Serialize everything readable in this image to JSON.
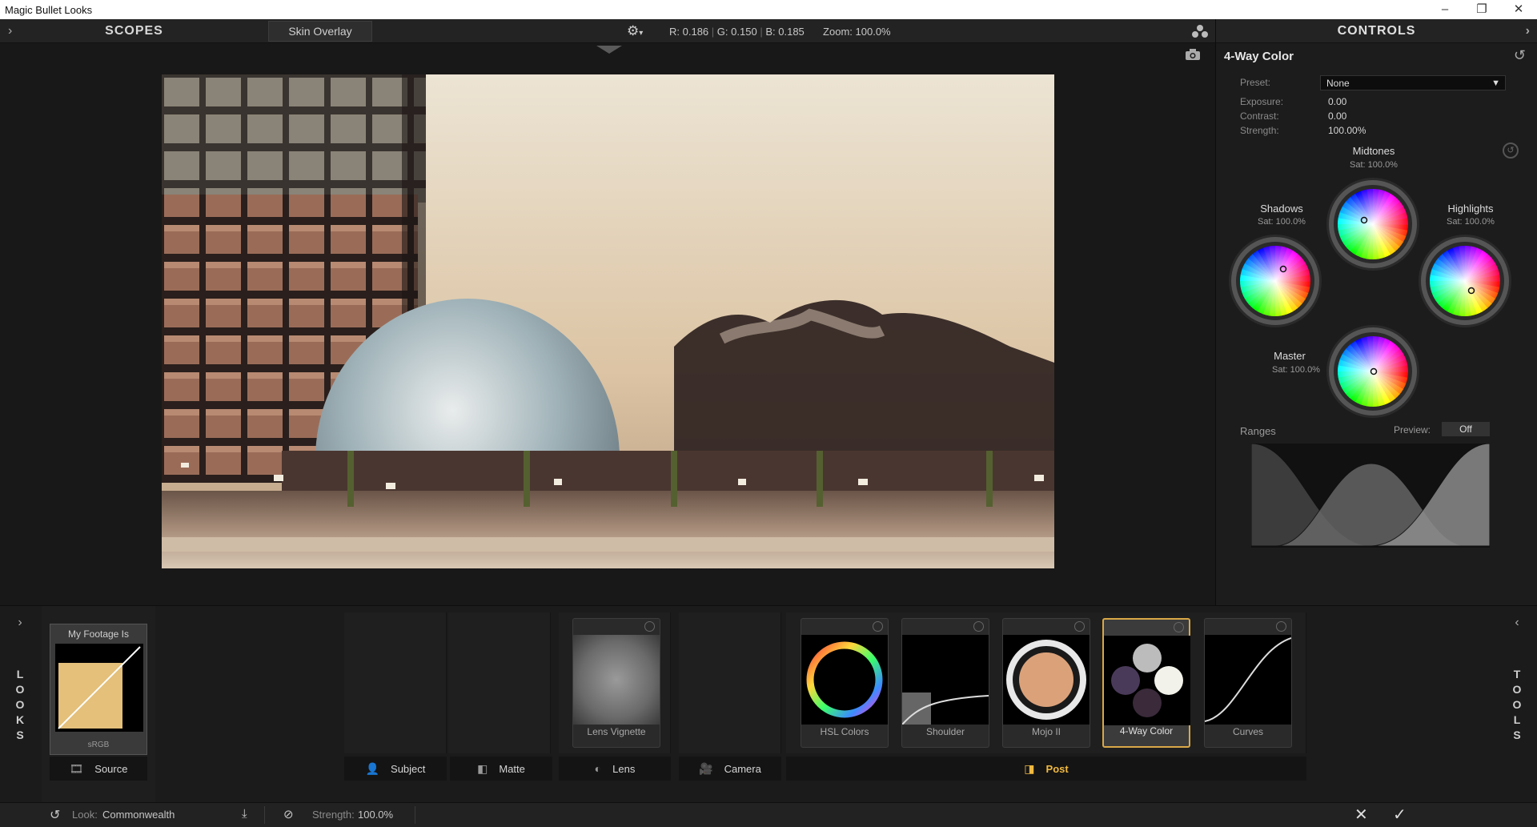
{
  "window": {
    "title": "Magic Bullet Looks",
    "minimize": "–",
    "maximize": "❐",
    "close": "✕"
  },
  "toolbar": {
    "scopes": "SCOPES",
    "skin_overlay": "Skin Overlay",
    "r_label": "R:",
    "r_value": "0.186",
    "g_label": "G:",
    "g_value": "0.150",
    "b_label": "B:",
    "b_value": "0.185",
    "zoom_label": "Zoom:",
    "zoom_value": "100.0%"
  },
  "controls": {
    "header": "CONTROLS",
    "tool_title": "4-Way Color",
    "preset_label": "Preset:",
    "preset_value": "None",
    "exposure_label": "Exposure:",
    "exposure_value": "0.00",
    "contrast_label": "Contrast:",
    "contrast_value": "0.00",
    "strength_label": "Strength:",
    "strength_value": "100.00%",
    "wheels": {
      "midtones": {
        "label": "Midtones",
        "sat": "Sat: 100.0%"
      },
      "shadows": {
        "label": "Shadows",
        "sat": "Sat: 100.0%"
      },
      "highlights": {
        "label": "Highlights",
        "sat": "Sat: 100.0%"
      },
      "master": {
        "label": "Master",
        "sat": "Sat: 100.0%"
      }
    },
    "ranges_label": "Ranges",
    "preview_label": "Preview:",
    "preview_value": "Off"
  },
  "looks_panel": {
    "side_left": "LOOKS",
    "side_right": "TOOLS",
    "source_header": "My Footage Is",
    "source_space": "sRGB",
    "categories": {
      "source": "Source",
      "subject": "Subject",
      "matte": "Matte",
      "lens": "Lens",
      "camera": "Camera",
      "post": "Post"
    },
    "tools": {
      "lens_vignette": "Lens Vignette",
      "hsl_colors": "HSL Colors",
      "shoulder": "Shoulder",
      "mojo": "Mojo II",
      "four_way": "4-Way Color",
      "curves": "Curves"
    }
  },
  "status": {
    "look_label": "Look:",
    "look_name": "Commonwealth",
    "strength_label": "Strength:",
    "strength_value": "100.0%"
  },
  "colors": {
    "accent": "#d9a847",
    "post_label": "#f0b840"
  }
}
